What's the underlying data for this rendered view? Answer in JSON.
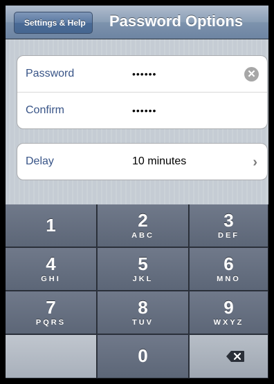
{
  "nav": {
    "back_label": "Settings & Help",
    "title": "Password Options"
  },
  "password_group": {
    "password_label": "Password",
    "password_value": "••••••",
    "confirm_label": "Confirm",
    "confirm_value": "••••••"
  },
  "delay_group": {
    "delay_label": "Delay",
    "delay_value": "10 minutes"
  },
  "keypad": {
    "keys": [
      {
        "digit": "1",
        "letters": ""
      },
      {
        "digit": "2",
        "letters": "ABC"
      },
      {
        "digit": "3",
        "letters": "DEF"
      },
      {
        "digit": "4",
        "letters": "GHI"
      },
      {
        "digit": "5",
        "letters": "JKL"
      },
      {
        "digit": "6",
        "letters": "MNO"
      },
      {
        "digit": "7",
        "letters": "PQRS"
      },
      {
        "digit": "8",
        "letters": "TUV"
      },
      {
        "digit": "9",
        "letters": "WXYZ"
      },
      {
        "digit": "0",
        "letters": ""
      }
    ]
  },
  "icons": {
    "clear": "clear-circle-icon",
    "disclosure": "chevron-right-icon",
    "delete": "backspace-icon"
  }
}
